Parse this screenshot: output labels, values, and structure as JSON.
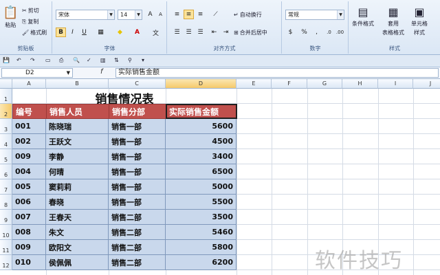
{
  "ribbon": {
    "clipboard": {
      "paste": "粘贴",
      "cut": "剪切",
      "copy": "复制",
      "format_painter": "格式刷",
      "label": "剪贴板"
    },
    "font": {
      "name": "宋体",
      "size": "14",
      "label": "字体"
    },
    "alignment": {
      "wrap": "自动换行",
      "merge": "合并后居中",
      "label": "对齐方式"
    },
    "number": {
      "format": "常规",
      "label": "数字"
    },
    "styles": {
      "conditional": "条件格式",
      "table": "套用",
      "table2": "表格格式",
      "cell": "单元格",
      "cell2": "样式",
      "label": "样式"
    }
  },
  "formula_bar": {
    "name_box": "D2",
    "fx": "f",
    "content": "实际销售金额"
  },
  "columns": [
    "A",
    "B",
    "C",
    "D",
    "E",
    "F",
    "G",
    "H",
    "I",
    "J"
  ],
  "rows": [
    "1",
    "2",
    "3",
    "4",
    "5",
    "6",
    "7",
    "8",
    "9",
    "10",
    "11",
    "12"
  ],
  "sheet": {
    "title": "销售情况表",
    "headers": [
      "编号",
      "销售人员",
      "销售分部",
      "实际销售金额"
    ],
    "data": [
      [
        "001",
        "陈晓瑞",
        "销售一部",
        "5600"
      ],
      [
        "002",
        "王跃文",
        "销售一部",
        "4500"
      ],
      [
        "009",
        "李静",
        "销售一部",
        "3400"
      ],
      [
        "004",
        "何晴",
        "销售一部",
        "6500"
      ],
      [
        "005",
        "窦莉莉",
        "销售一部",
        "5000"
      ],
      [
        "006",
        "春晓",
        "销售一部",
        "5500"
      ],
      [
        "007",
        "王春天",
        "销售二部",
        "3500"
      ],
      [
        "008",
        "朱文",
        "销售二部",
        "5460"
      ],
      [
        "009",
        "欧阳文",
        "销售二部",
        "5800"
      ],
      [
        "010",
        "侯佩佩",
        "销售二部",
        "6200"
      ]
    ]
  },
  "watermark": "软件技巧"
}
